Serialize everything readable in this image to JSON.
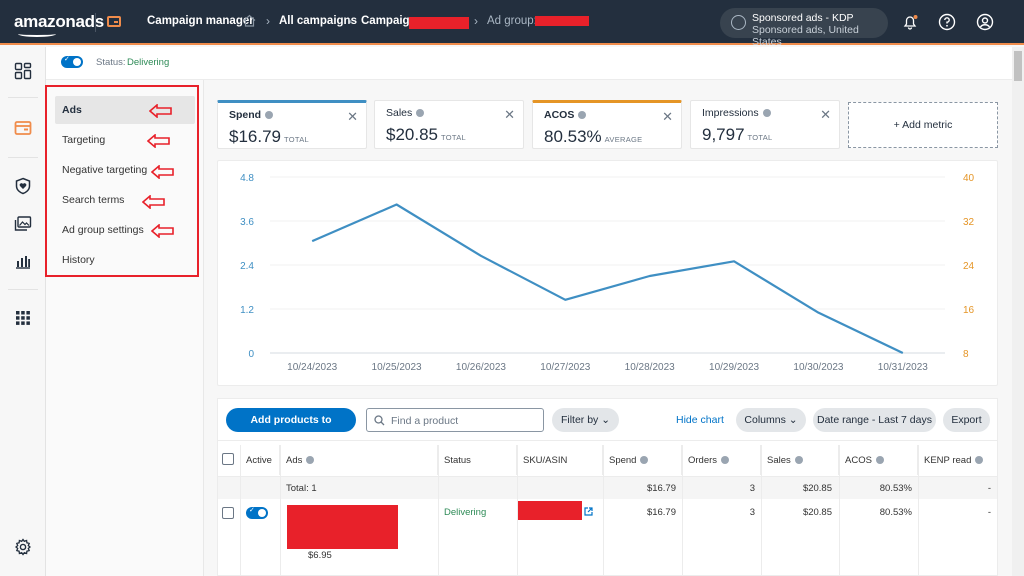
{
  "header": {
    "logo": "amazonads",
    "app_title": "Campaign manager",
    "breadcrumbs": [
      {
        "label": "All campaigns"
      },
      {
        "label": "Campaign:"
      },
      {
        "label": "Ad group:"
      }
    ],
    "account": {
      "name": "Sponsored ads - KDP",
      "detail": "Sponsored ads, United States"
    },
    "icons": [
      "bell-icon",
      "help-icon",
      "profile-icon"
    ],
    "notification_dot_color": "#f08c4b"
  },
  "rail": {
    "items": [
      "dashboard-icon",
      "campaign-manager-icon",
      "brand-shield-icon",
      "creative-icon",
      "reports-icon",
      "apps-grid-icon",
      "settings-icon"
    ]
  },
  "status": {
    "enabled": true,
    "label": "Status:",
    "value": "Delivering"
  },
  "subnav": {
    "items": [
      {
        "label": "Ads",
        "active": true
      },
      {
        "label": "Targeting"
      },
      {
        "label": "Negative targeting"
      },
      {
        "label": "Search terms"
      },
      {
        "label": "Ad group settings"
      },
      {
        "label": "History"
      }
    ]
  },
  "metrics": [
    {
      "title": "Spend",
      "value": "$16.79",
      "sub": "TOTAL",
      "accent": "#3f8fc3"
    },
    {
      "title": "Sales",
      "value": "$20.85",
      "sub": "TOTAL",
      "accent": ""
    },
    {
      "title": "ACOS",
      "value": "80.53%",
      "sub": "AVERAGE",
      "accent": "#e59526"
    },
    {
      "title": "Impressions",
      "value": "9,797",
      "sub": "TOTAL",
      "accent": ""
    }
  ],
  "add_metric": "+ Add metric",
  "chart_data": {
    "type": "line",
    "title": "",
    "x": [
      "10/24/2023",
      "10/25/2023",
      "10/26/2023",
      "10/27/2023",
      "10/28/2023",
      "10/29/2023",
      "10/30/2023",
      "10/31/2023"
    ],
    "series": [
      {
        "name": "Spend",
        "axis": "left",
        "color": "#3f8fc3",
        "values": [
          3.05,
          4.05,
          2.65,
          1.45,
          2.1,
          2.5,
          1.1,
          0
        ]
      }
    ],
    "ylim_left": [
      0,
      4.8
    ],
    "yticks_left": [
      "0",
      "1.2",
      "2.4",
      "3.6",
      "4.8"
    ],
    "ylim_right": [
      8,
      40
    ],
    "yticks_right": [
      "8",
      "16",
      "24",
      "32",
      "40"
    ],
    "left_axis_color": "#3f8fc3",
    "right_axis_color": "#e59526",
    "grid": true,
    "xlabel": "",
    "ylabel": ""
  },
  "toolbar": {
    "add_products": "Add products to advertise",
    "search_placeholder": "Find a product",
    "filter": "Filter by",
    "hide_chart": "Hide chart",
    "columns": "Columns",
    "date_range": "Date range - Last 7 days",
    "export": "Export"
  },
  "table": {
    "columns": [
      "Active",
      "Ads",
      "Status",
      "SKU/ASIN",
      "Spend",
      "Orders",
      "Sales",
      "ACOS",
      "KENP read"
    ],
    "total_row": {
      "label": "Total: 1",
      "spend": "$16.79",
      "orders": "3",
      "sales": "$20.85",
      "acos": "80.53%",
      "kenp": "-"
    },
    "rows": [
      {
        "active": true,
        "price": "$6.95",
        "status": "Delivering",
        "spend": "$16.79",
        "orders": "3",
        "sales": "$20.85",
        "acos": "80.53%",
        "kenp": "-"
      }
    ]
  }
}
